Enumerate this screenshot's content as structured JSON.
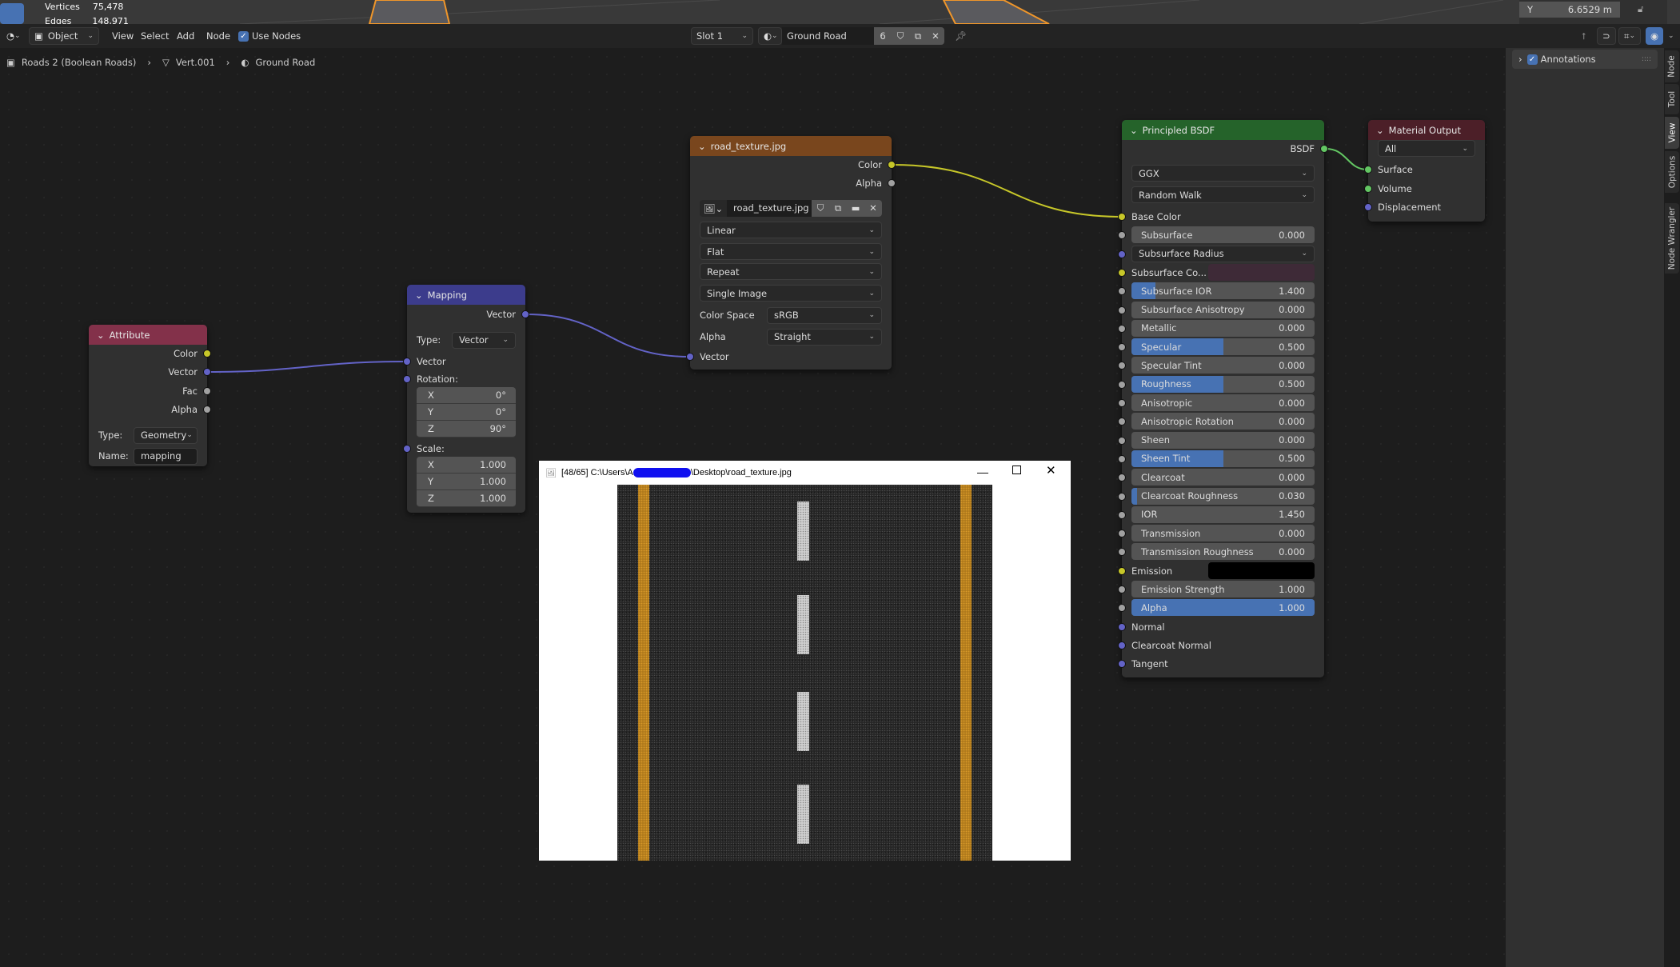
{
  "viewport": {
    "stats": [
      {
        "label": "Vertices",
        "value": "75,478"
      },
      {
        "label": "Edges",
        "value": "148,971"
      }
    ],
    "transform_y": {
      "label": "Y",
      "value": "6.6529 m"
    }
  },
  "header": {
    "mode": "Object",
    "menus": [
      "View",
      "Select",
      "Add",
      "Node"
    ],
    "use_nodes_label": "Use Nodes",
    "use_nodes_checked": true,
    "slot": "Slot 1",
    "material_name": "Ground Road",
    "user_count": "6"
  },
  "breadcrumb": [
    "Roads 2 (Boolean Roads)",
    "Vert.001",
    "Ground Road"
  ],
  "sidebar": {
    "panel": "Annotations",
    "tabs": [
      "Node",
      "Tool",
      "View",
      "Options",
      "Node Wrangler"
    ],
    "active_tab": "View"
  },
  "colors": {
    "socket_color": "#c7c729",
    "socket_float": "#a1a1a1",
    "socket_vector": "#6363c7",
    "socket_shader": "#63c763",
    "slider_fill": "#4772b3"
  },
  "nodes": {
    "attribute": {
      "title": "Attribute",
      "outputs": [
        "Color",
        "Vector",
        "Fac",
        "Alpha"
      ],
      "type_label": "Type:",
      "type_value": "Geometry",
      "name_label": "Name:",
      "name_value": "mapping"
    },
    "mapping": {
      "title": "Mapping",
      "output": "Vector",
      "type_label": "Type:",
      "type_value": "Vector",
      "vector_input": "Vector",
      "rotation_label": "Rotation:",
      "rotation": [
        {
          "axis": "X",
          "value": "0°"
        },
        {
          "axis": "Y",
          "value": "0°"
        },
        {
          "axis": "Z",
          "value": "90°"
        }
      ],
      "scale_label": "Scale:",
      "scale": [
        {
          "axis": "X",
          "value": "1.000"
        },
        {
          "axis": "Y",
          "value": "1.000"
        },
        {
          "axis": "Z",
          "value": "1.000"
        }
      ]
    },
    "image_texture": {
      "title": "road_texture.jpg",
      "outputs": [
        "Color",
        "Alpha"
      ],
      "image": "road_texture.jpg",
      "interpolation": "Linear",
      "projection": "Flat",
      "extension": "Repeat",
      "source": "Single Image",
      "color_space_label": "Color Space",
      "color_space": "sRGB",
      "alpha_label": "Alpha",
      "alpha_mode": "Straight",
      "vector_input": "Vector"
    },
    "principled": {
      "title": "Principled BSDF",
      "output": "BSDF",
      "distribution": "GGX",
      "subsurface_method": "Random Walk",
      "inputs": [
        {
          "kind": "label",
          "label": "Base Color",
          "socket": "yellow"
        },
        {
          "kind": "slider",
          "label": "Subsurface",
          "value": "0.000",
          "fill": 0,
          "socket": "grey"
        },
        {
          "kind": "select",
          "label": "Subsurface Radius",
          "socket": "blue"
        },
        {
          "kind": "color",
          "label": "Subsurface Co...",
          "color": "#3e2a37",
          "socket": "yellow"
        },
        {
          "kind": "slider",
          "label": "Subsurface IOR",
          "value": "1.400",
          "fill": 0.13,
          "socket": "grey"
        },
        {
          "kind": "slider",
          "label": "Subsurface Anisotropy",
          "value": "0.000",
          "fill": 0,
          "socket": "grey"
        },
        {
          "kind": "slider",
          "label": "Metallic",
          "value": "0.000",
          "fill": 0,
          "socket": "grey"
        },
        {
          "kind": "slider",
          "label": "Specular",
          "value": "0.500",
          "fill": 0.5,
          "socket": "grey"
        },
        {
          "kind": "slider",
          "label": "Specular Tint",
          "value": "0.000",
          "fill": 0,
          "socket": "grey"
        },
        {
          "kind": "slider",
          "label": "Roughness",
          "value": "0.500",
          "fill": 0.5,
          "socket": "grey"
        },
        {
          "kind": "slider",
          "label": "Anisotropic",
          "value": "0.000",
          "fill": 0,
          "socket": "grey"
        },
        {
          "kind": "slider",
          "label": "Anisotropic Rotation",
          "value": "0.000",
          "fill": 0,
          "socket": "grey"
        },
        {
          "kind": "slider",
          "label": "Sheen",
          "value": "0.000",
          "fill": 0,
          "socket": "grey"
        },
        {
          "kind": "slider",
          "label": "Sheen Tint",
          "value": "0.500",
          "fill": 0.5,
          "socket": "grey"
        },
        {
          "kind": "slider",
          "label": "Clearcoat",
          "value": "0.000",
          "fill": 0,
          "socket": "grey"
        },
        {
          "kind": "slider",
          "label": "Clearcoat Roughness",
          "value": "0.030",
          "fill": 0.03,
          "socket": "grey"
        },
        {
          "kind": "slider",
          "label": "IOR",
          "value": "1.450",
          "fill": 0,
          "socket": "grey"
        },
        {
          "kind": "slider",
          "label": "Transmission",
          "value": "0.000",
          "fill": 0,
          "socket": "grey"
        },
        {
          "kind": "slider",
          "label": "Transmission Roughness",
          "value": "0.000",
          "fill": 0,
          "socket": "grey"
        },
        {
          "kind": "color",
          "label": "Emission",
          "color": "#000000",
          "socket": "yellow"
        },
        {
          "kind": "slider",
          "label": "Emission Strength",
          "value": "1.000",
          "fill": 0,
          "socket": "grey"
        },
        {
          "kind": "slider",
          "label": "Alpha",
          "value": "1.000",
          "fill": 1,
          "socket": "grey"
        },
        {
          "kind": "label",
          "label": "Normal",
          "socket": "blue"
        },
        {
          "kind": "label",
          "label": "Clearcoat Normal",
          "socket": "blue"
        },
        {
          "kind": "label",
          "label": "Tangent",
          "socket": "blue"
        }
      ]
    },
    "material_output": {
      "title": "Material Output",
      "target": "All",
      "inputs": [
        "Surface",
        "Volume",
        "Displacement"
      ]
    }
  },
  "image_viewer": {
    "title_prefix": "[48/65] C:\\Users\\A",
    "title_suffix": "\\Desktop\\road_texture.jpg"
  }
}
